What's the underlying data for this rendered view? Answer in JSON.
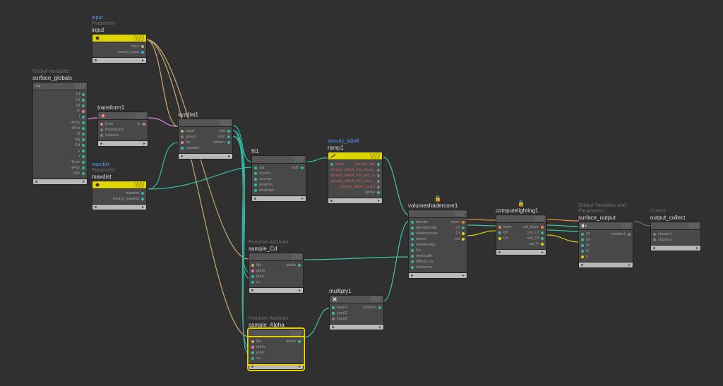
{
  "nodes": {
    "input": {
      "blue_label": "input",
      "grey_label": "Parameter",
      "title": "input",
      "ports_r": [
        "input",
        "bound_input"
      ]
    },
    "surface_globals": {
      "grey_label": "Global Variables",
      "title": "surface_globals",
      "ports_r": [
        "Cf",
        "Of",
        "Af",
        "P",
        "I",
        "dPds",
        "dPdt",
        "N",
        "Ng",
        "Cd",
        "s",
        "t",
        "Time",
        "dPdz",
        "SID"
      ]
    },
    "transform1": {
      "title": "transform1",
      "ports_l": [
        "from",
        "fromspace",
        "tospace"
      ],
      "ports_r": [
        "to"
      ]
    },
    "maxdist": {
      "blue_label": "maxdist",
      "grey_label": "Parameter",
      "title": "maxdist",
      "ports_r": [
        "maxdist",
        "bound_maxdist"
      ]
    },
    "xyzdist1": {
      "title": "xyzdist1",
      "ports_l": [
        "input",
        "group",
        "file",
        "maxdist"
      ],
      "ports_r": [
        "dist",
        "prim",
        "primuv"
      ]
    },
    "fit1": {
      "title": "fit1",
      "ports_l": [
        "val",
        "srcmin",
        "srcmax",
        "destmin",
        "destmax"
      ],
      "ports_r": [
        "shift"
      ]
    },
    "ramp1": {
      "blue_label": "density_falloff",
      "title": "ramp1",
      "ports_l": [
        "input"
      ],
      "ports_r": [
        "density_falloff",
        "density_falloff_the_basis_str…",
        "density_falloff_the_key_posit…",
        "density_falloff_the_color_sp…",
        "density_falloff_struct",
        "spline"
      ]
    },
    "sample_cd": {
      "grey_label": "Primitive Attribute",
      "title": "sample_Cd",
      "ports_l": [
        "file",
        "attrib",
        "prim",
        "uv"
      ],
      "ports_r": [
        "adata"
      ]
    },
    "sample_alpha": {
      "grey_label": "Primitive Attribute",
      "title": "sample_Alpha",
      "ports_l": [
        "file",
        "attrib",
        "prim",
        "uv"
      ],
      "ports_r": [
        "adata"
      ]
    },
    "multiply1": {
      "title": "multiply1",
      "ports_l": [
        "input1",
        "input2",
        "input3"
      ],
      "ports_r": [
        "product"
      ]
    },
    "volumeshadercore1": {
      "title": "volumeshadercore1",
      "ports_l": [
        "density",
        "densityscale",
        "shadowscale",
        "phase",
        "emitdensity",
        "Ce",
        "emitscale",
        "diffuse_clr",
        "emittance"
      ],
      "ports_r": [
        "layer",
        "Of",
        "Cf",
        "Ce"
      ]
    },
    "computelighting1": {
      "title": "computelighting1",
      "ports_l": [
        "layer",
        "Of",
        "Ce"
      ],
      "ports_r": [
        "out_layer",
        "out_Cf",
        "out_Of",
        "out_F"
      ]
    },
    "surface_output": {
      "grey_label": "Output Variables and Parameters",
      "title": "surface_output",
      "ports_l": [
        "Cf",
        "Of",
        "Af",
        "N",
        "F"
      ],
      "ports_r": [
        "shader1"
      ]
    },
    "output_collect": {
      "grey_label": "Collect",
      "title": "output_collect",
      "ports_l": [
        "shader1",
        "shader2"
      ]
    }
  }
}
